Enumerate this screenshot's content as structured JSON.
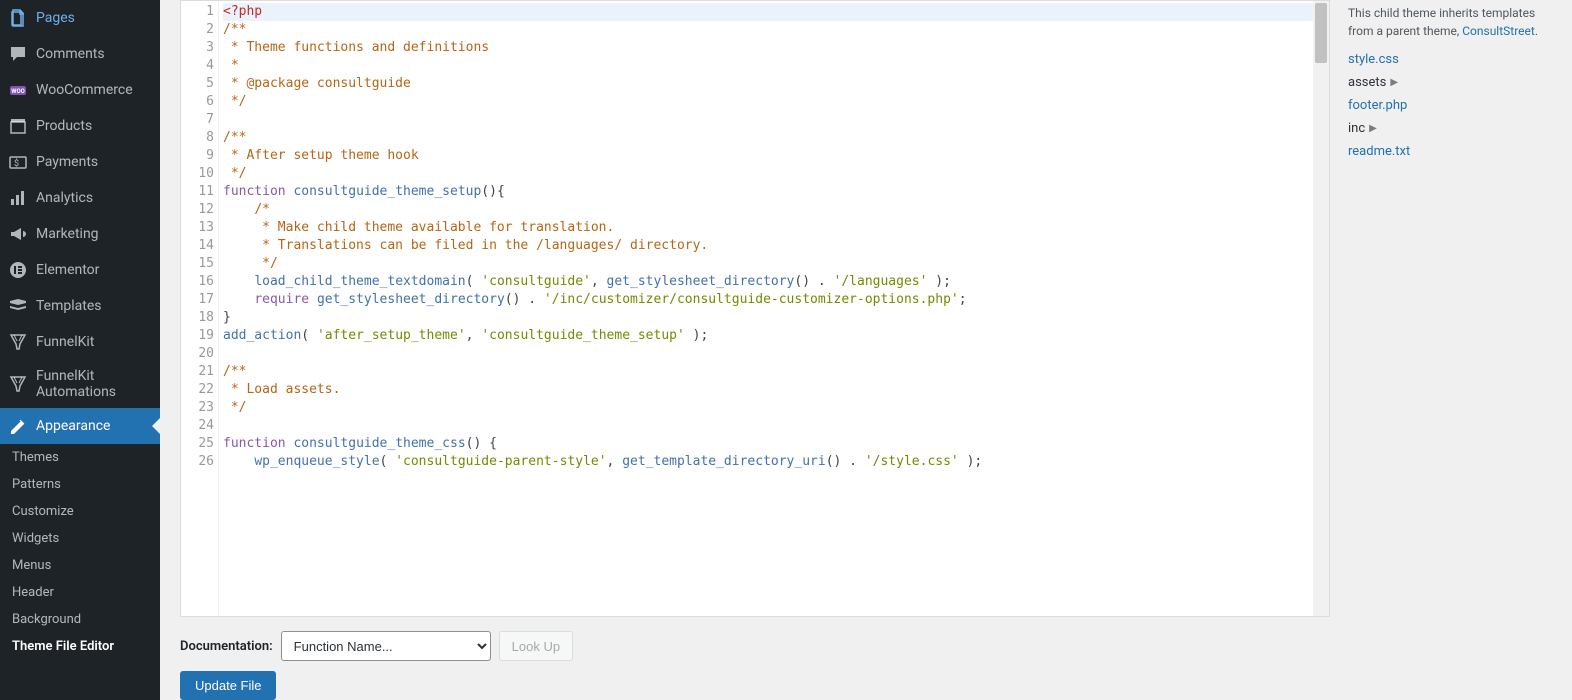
{
  "sidebar": {
    "items": [
      {
        "label": "Pages",
        "icon": "pages"
      },
      {
        "label": "Comments",
        "icon": "comments"
      },
      {
        "label": "WooCommerce",
        "icon": "woo"
      },
      {
        "label": "Products",
        "icon": "products"
      },
      {
        "label": "Payments",
        "icon": "payments"
      },
      {
        "label": "Analytics",
        "icon": "analytics"
      },
      {
        "label": "Marketing",
        "icon": "marketing"
      },
      {
        "label": "Elementor",
        "icon": "elementor"
      },
      {
        "label": "Templates",
        "icon": "templates"
      },
      {
        "label": "FunnelKit",
        "icon": "funnelkit"
      },
      {
        "label": "FunnelKit Automations",
        "icon": "funnelkit"
      },
      {
        "label": "Appearance",
        "icon": "appearance",
        "current": true
      }
    ],
    "sub_items": [
      {
        "label": "Themes"
      },
      {
        "label": "Patterns"
      },
      {
        "label": "Customize"
      },
      {
        "label": "Widgets"
      },
      {
        "label": "Menus"
      },
      {
        "label": "Header"
      },
      {
        "label": "Background"
      },
      {
        "label": "Theme File Editor",
        "active": true
      }
    ]
  },
  "editor": {
    "lines": [
      {
        "n": 1,
        "html": "<span class='b'>&lt;?php</span>",
        "hl": true
      },
      {
        "n": 2,
        "html": "<span class='c'>/**</span>"
      },
      {
        "n": 3,
        "html": "<span class='c'> * Theme functions and definitions</span>"
      },
      {
        "n": 4,
        "html": "<span class='c'> *</span>"
      },
      {
        "n": 5,
        "html": "<span class='c'> * @package consultguide</span>"
      },
      {
        "n": 6,
        "html": "<span class='c'> */</span>"
      },
      {
        "n": 7,
        "html": ""
      },
      {
        "n": 8,
        "html": "<span class='c'>/**</span>"
      },
      {
        "n": 9,
        "html": "<span class='c'> * After setup theme hook</span>"
      },
      {
        "n": 10,
        "html": "<span class='c'> */</span>"
      },
      {
        "n": 11,
        "html": "<span class='k'>function</span> <span class='p'>consultguide_theme_setup</span>(){"
      },
      {
        "n": 12,
        "html": "    <span class='c'>/*</span>"
      },
      {
        "n": 13,
        "html": "<span class='c'>     * Make child theme available for translation.</span>"
      },
      {
        "n": 14,
        "html": "<span class='c'>     * Translations can be filed in the /languages/ directory.</span>"
      },
      {
        "n": 15,
        "html": "<span class='c'>     */</span>"
      },
      {
        "n": 16,
        "html": "    <span class='p'>load_child_theme_textdomain</span>( <span class='s'>'consultguide'</span>, <span class='p'>get_stylesheet_directory</span>() . <span class='s'>'/languages'</span> );"
      },
      {
        "n": 17,
        "html": "    <span class='k'>require</span> <span class='p'>get_stylesheet_directory</span>() . <span class='s'>'/inc/customizer/consultguide-customizer-options.php'</span>;"
      },
      {
        "n": 18,
        "html": "}"
      },
      {
        "n": 19,
        "html": "<span class='p'>add_action</span>( <span class='s'>'after_setup_theme'</span>, <span class='s'>'consultguide_theme_setup'</span> );"
      },
      {
        "n": 20,
        "html": ""
      },
      {
        "n": 21,
        "html": "<span class='c'>/**</span>"
      },
      {
        "n": 22,
        "html": "<span class='c'> * Load assets.</span>"
      },
      {
        "n": 23,
        "html": "<span class='c'> */</span>"
      },
      {
        "n": 24,
        "html": ""
      },
      {
        "n": 25,
        "html": "<span class='k'>function</span> <span class='p'>consultguide_theme_css</span>() {"
      },
      {
        "n": 26,
        "html": "    <span class='p'>wp_enqueue_style</span>( <span class='s'>'consultguide-parent-style'</span>, <span class='p'>get_template_directory_uri</span>() . <span class='s'>'/style.css'</span> );"
      }
    ]
  },
  "files": {
    "desc_prefix": "This child theme inherits templates from a parent theme, ",
    "parent_theme": "ConsultStreet",
    "items": [
      {
        "label": "style.css",
        "type": "file"
      },
      {
        "label": "assets",
        "type": "folder"
      },
      {
        "label": "footer.php",
        "type": "file"
      },
      {
        "label": "inc",
        "type": "folder"
      },
      {
        "label": "readme.txt",
        "type": "file"
      }
    ]
  },
  "doc": {
    "label": "Documentation:",
    "placeholder": "Function Name...",
    "lookup": "Look Up"
  },
  "update_button": "Update File"
}
